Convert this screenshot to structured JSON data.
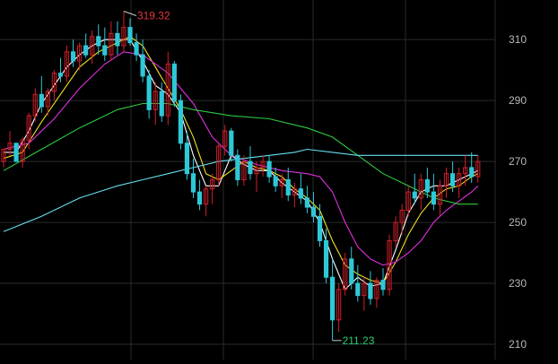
{
  "chart_data": {
    "type": "candlestick",
    "ylim": [
      205,
      323
    ],
    "y_ticks": [
      {
        "value": 310,
        "label": "310"
      },
      {
        "value": 290,
        "label": "290"
      },
      {
        "value": 270,
        "label": "270"
      },
      {
        "value": 250,
        "label": "250"
      },
      {
        "value": 230,
        "label": "230"
      },
      {
        "value": 210,
        "label": "210"
      }
    ],
    "grid": true,
    "colors": {
      "background": "#000000",
      "grid": "#2a2a2a",
      "up": "#d0202a",
      "down": "#2ec8d8",
      "tick_label": "#b8b8b8",
      "max_label": "#e8343c",
      "min_label": "#2ecc71",
      "arrow": "#cccccc"
    },
    "annotations": {
      "max": {
        "label": "319.32",
        "value": 319.32
      },
      "min": {
        "label": "211.23",
        "value": 211.23
      }
    },
    "candles": [
      [
        0,
        270,
        274,
        268,
        274
      ],
      [
        1,
        274,
        280,
        272,
        276
      ],
      [
        2,
        276,
        276,
        270,
        270
      ],
      [
        3,
        270,
        278,
        268,
        277
      ],
      [
        4,
        277,
        286,
        274,
        285
      ],
      [
        5,
        285,
        294,
        283,
        292
      ],
      [
        6,
        292,
        298,
        286,
        288
      ],
      [
        7,
        288,
        294,
        285,
        293
      ],
      [
        8,
        293,
        300,
        290,
        299
      ],
      [
        9,
        299,
        304,
        296,
        298
      ],
      [
        10,
        298,
        308,
        296,
        306
      ],
      [
        11,
        306,
        310,
        301,
        303
      ],
      [
        12,
        303,
        309,
        300,
        308
      ],
      [
        13,
        308,
        312,
        304,
        305
      ],
      [
        14,
        305,
        313,
        302,
        311
      ],
      [
        15,
        311,
        315,
        305,
        308
      ],
      [
        16,
        308,
        314,
        303,
        305
      ],
      [
        17,
        305,
        316,
        303,
        312
      ],
      [
        18,
        312,
        316,
        305,
        308
      ],
      [
        19,
        308,
        319.32,
        306,
        314
      ],
      [
        20,
        314,
        317,
        308,
        309
      ],
      [
        21,
        309,
        312,
        303,
        305
      ],
      [
        22,
        305,
        310,
        296,
        298
      ],
      [
        23,
        298,
        300,
        284,
        287
      ],
      [
        24,
        287,
        296,
        282,
        293
      ],
      [
        25,
        293,
        296,
        283,
        285
      ],
      [
        26,
        285,
        306,
        282,
        302
      ],
      [
        27,
        302,
        303,
        288,
        290
      ],
      [
        28,
        290,
        292,
        274,
        276
      ],
      [
        29,
        276,
        280,
        264,
        266
      ],
      [
        30,
        266,
        271,
        258,
        260
      ],
      [
        31,
        260,
        264,
        254,
        256
      ],
      [
        32,
        256,
        262,
        252,
        261
      ],
      [
        33,
        261,
        266,
        256,
        264
      ],
      [
        34,
        264,
        276,
        262,
        275
      ],
      [
        35,
        275,
        282,
        272,
        280
      ],
      [
        36,
        280,
        281,
        270,
        272
      ],
      [
        37,
        272,
        274,
        262,
        264
      ],
      [
        38,
        264,
        272,
        262,
        270
      ],
      [
        39,
        270,
        275,
        264,
        266
      ],
      [
        40,
        266,
        270,
        260,
        268
      ],
      [
        41,
        268,
        272,
        265,
        270
      ],
      [
        42,
        270,
        272,
        263,
        265
      ],
      [
        43,
        265,
        268,
        260,
        262
      ],
      [
        44,
        262,
        266,
        258,
        264
      ],
      [
        45,
        264,
        268,
        257,
        259
      ],
      [
        46,
        259,
        263,
        255,
        261
      ],
      [
        47,
        261,
        266,
        256,
        258
      ],
      [
        48,
        258,
        262,
        253,
        255
      ],
      [
        49,
        255,
        260,
        250,
        252
      ],
      [
        50,
        252,
        256,
        242,
        244
      ],
      [
        51,
        244,
        248,
        230,
        232
      ],
      [
        52,
        232,
        238,
        211.23,
        218
      ],
      [
        53,
        218,
        230,
        214,
        228
      ],
      [
        54,
        228,
        240,
        226,
        238
      ],
      [
        55,
        238,
        242,
        228,
        230
      ],
      [
        56,
        230,
        236,
        224,
        226
      ],
      [
        57,
        226,
        232,
        221,
        230
      ],
      [
        58,
        230,
        234,
        223,
        225
      ],
      [
        59,
        225,
        232,
        222,
        231
      ],
      [
        60,
        231,
        235,
        226,
        228
      ],
      [
        61,
        228,
        246,
        226,
        244
      ],
      [
        62,
        244,
        252,
        242,
        250
      ],
      [
        63,
        250,
        256,
        246,
        254
      ],
      [
        64,
        254,
        262,
        252,
        260
      ],
      [
        65,
        260,
        266,
        256,
        258
      ],
      [
        66,
        258,
        266,
        254,
        264
      ],
      [
        67,
        264,
        268,
        258,
        260
      ],
      [
        68,
        260,
        266,
        254,
        256
      ],
      [
        69,
        256,
        264,
        252,
        262
      ],
      [
        70,
        262,
        268,
        258,
        266
      ],
      [
        71,
        266,
        270,
        260,
        262
      ],
      [
        72,
        262,
        268,
        258,
        266
      ],
      [
        73,
        266,
        272,
        262,
        268
      ],
      [
        74,
        268,
        273,
        263,
        265
      ],
      [
        75,
        265,
        272,
        263,
        270
      ]
    ],
    "moving_averages": [
      {
        "color": "#ffffff",
        "values": [
          [
            0,
            273
          ],
          [
            2,
            273
          ],
          [
            4,
            280
          ],
          [
            6,
            289
          ],
          [
            8,
            295
          ],
          [
            10,
            301
          ],
          [
            12,
            305
          ],
          [
            14,
            308
          ],
          [
            16,
            310
          ],
          [
            18,
            310
          ],
          [
            20,
            310
          ],
          [
            22,
            303
          ],
          [
            24,
            295
          ],
          [
            26,
            292
          ],
          [
            28,
            286
          ],
          [
            30,
            272
          ],
          [
            32,
            262
          ],
          [
            34,
            262
          ],
          [
            36,
            272
          ],
          [
            38,
            269
          ],
          [
            40,
            267
          ],
          [
            42,
            267
          ],
          [
            44,
            263
          ],
          [
            46,
            260
          ],
          [
            48,
            257
          ],
          [
            50,
            250
          ],
          [
            52,
            238
          ],
          [
            54,
            228
          ],
          [
            56,
            232
          ],
          [
            58,
            229
          ],
          [
            60,
            230
          ],
          [
            62,
            241
          ],
          [
            64,
            253
          ],
          [
            66,
            260
          ],
          [
            68,
            262
          ],
          [
            70,
            262
          ],
          [
            72,
            264
          ],
          [
            74,
            266
          ],
          [
            75,
            267
          ]
        ]
      },
      {
        "color": "#f0e020",
        "values": [
          [
            0,
            271
          ],
          [
            3,
            273
          ],
          [
            6,
            283
          ],
          [
            9,
            292
          ],
          [
            12,
            301
          ],
          [
            15,
            306
          ],
          [
            18,
            309
          ],
          [
            20,
            311
          ],
          [
            22,
            308
          ],
          [
            24,
            301
          ],
          [
            26,
            294
          ],
          [
            28,
            287
          ],
          [
            30,
            278
          ],
          [
            32,
            266
          ],
          [
            34,
            264
          ],
          [
            36,
            267
          ],
          [
            38,
            270
          ],
          [
            40,
            268
          ],
          [
            42,
            267
          ],
          [
            44,
            265
          ],
          [
            46,
            261
          ],
          [
            48,
            258
          ],
          [
            50,
            254
          ],
          [
            52,
            244
          ],
          [
            54,
            236
          ],
          [
            56,
            233
          ],
          [
            58,
            231
          ],
          [
            60,
            230
          ],
          [
            62,
            237
          ],
          [
            64,
            246
          ],
          [
            66,
            253
          ],
          [
            68,
            258
          ],
          [
            70,
            261
          ],
          [
            72,
            262
          ],
          [
            74,
            265
          ],
          [
            75,
            266
          ]
        ]
      },
      {
        "color": "#e030e0",
        "values": [
          [
            0,
            274
          ],
          [
            4,
            276
          ],
          [
            8,
            284
          ],
          [
            12,
            294
          ],
          [
            16,
            302
          ],
          [
            19,
            306
          ],
          [
            22,
            305
          ],
          [
            26,
            299
          ],
          [
            30,
            289
          ],
          [
            33,
            278
          ],
          [
            36,
            272
          ],
          [
            40,
            269
          ],
          [
            44,
            267
          ],
          [
            48,
            266
          ],
          [
            50,
            265
          ],
          [
            52,
            260
          ],
          [
            54,
            250
          ],
          [
            56,
            242
          ],
          [
            58,
            238
          ],
          [
            60,
            236
          ],
          [
            62,
            237
          ],
          [
            64,
            240
          ],
          [
            66,
            244
          ],
          [
            68,
            250
          ],
          [
            70,
            254
          ],
          [
            72,
            257
          ],
          [
            74,
            260
          ],
          [
            75,
            262
          ]
        ]
      },
      {
        "color": "#2ecc40",
        "values": [
          [
            0,
            267
          ],
          [
            6,
            274
          ],
          [
            12,
            281
          ],
          [
            18,
            287
          ],
          [
            22,
            289
          ],
          [
            26,
            289
          ],
          [
            30,
            287
          ],
          [
            36,
            285
          ],
          [
            42,
            284
          ],
          [
            48,
            281
          ],
          [
            52,
            278
          ],
          [
            56,
            272
          ],
          [
            60,
            266
          ],
          [
            64,
            262
          ],
          [
            68,
            258
          ],
          [
            72,
            256
          ],
          [
            75,
            256
          ]
        ]
      },
      {
        "color": "#66e0f0",
        "values": [
          [
            0,
            247
          ],
          [
            6,
            252
          ],
          [
            12,
            258
          ],
          [
            18,
            262
          ],
          [
            22,
            264
          ],
          [
            26,
            266
          ],
          [
            30,
            268
          ],
          [
            34,
            270
          ],
          [
            38,
            271
          ],
          [
            42,
            272
          ],
          [
            46,
            273
          ],
          [
            48,
            274
          ],
          [
            52,
            273
          ],
          [
            56,
            272
          ],
          [
            62,
            272
          ],
          [
            68,
            272
          ],
          [
            72,
            272
          ],
          [
            75,
            272
          ]
        ]
      }
    ]
  }
}
